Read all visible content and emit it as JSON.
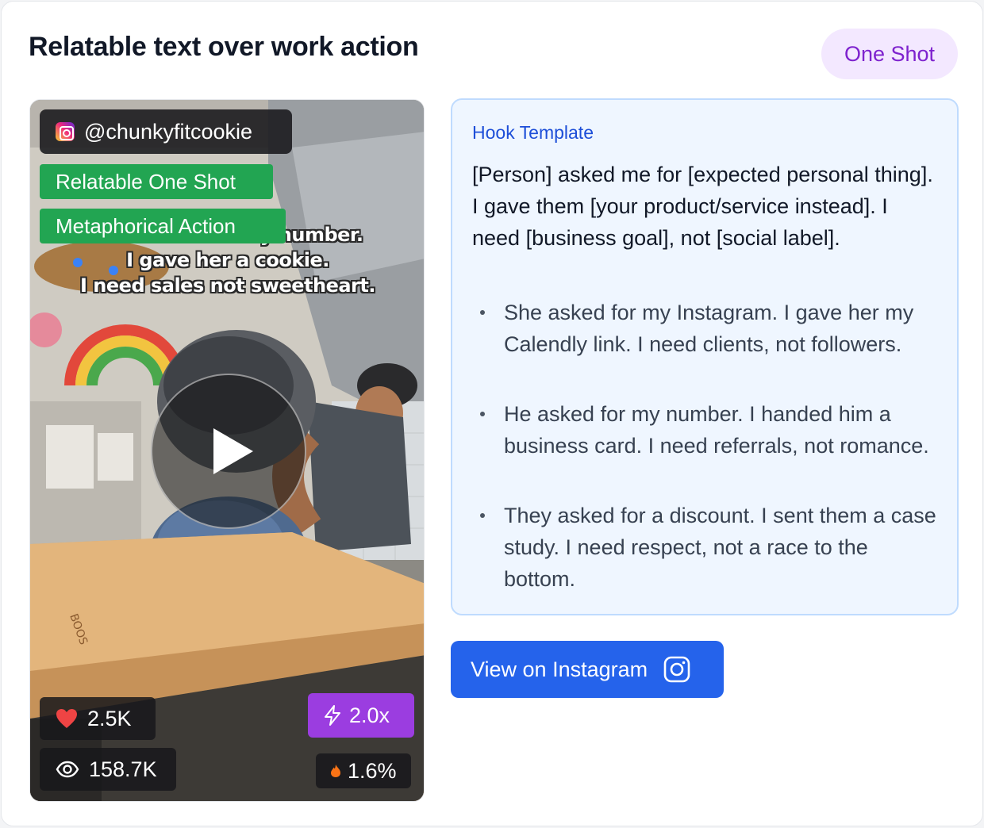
{
  "card": {
    "title": "Relatable text over work action",
    "type_badge": "One Shot"
  },
  "video": {
    "handle": "@chunkyfitcookie",
    "tags": [
      "Relatable One Shot",
      "Metaphorical Action"
    ],
    "caption_lines": [
      "She asked for my number.",
      "I gave her a cookie.",
      "I need sales not sweetheart."
    ],
    "board_brand": "BOOS",
    "likes": "2.5K",
    "views": "158.7K",
    "performance_ratio": "2.0x",
    "engagement_rate": "1.6%",
    "icons": {
      "platform": "instagram-icon",
      "play": "play-icon",
      "likes": "heart-icon",
      "views": "eye-icon",
      "ratio": "lightning-icon",
      "engagement": "flame-icon"
    }
  },
  "hook": {
    "label": "Hook Template",
    "template": "[Person] asked me for [expected personal thing]. I gave them [your product/service instead]. I need [business goal], not [social label].",
    "examples": [
      "She asked for my Instagram. I gave her my Calendly link. I need clients, not followers.",
      "He asked for my number. I handed him a business card. I need referrals, not romance.",
      "They asked for a discount. I sent them a case study. I need respect, not a race to the bottom."
    ]
  },
  "cta": {
    "label": "View on Instagram",
    "icon": "instagram-icon"
  },
  "colors": {
    "badge_bg": "#f3e8ff",
    "badge_text": "#7e22ce",
    "tag_green": "#22a552",
    "ratio_purple": "#9b3de0",
    "hook_bg": "#eff6ff",
    "hook_border": "#bfdbfe",
    "hook_label": "#1d4ed8",
    "button_blue": "#2563eb",
    "heart_red": "#ef4444",
    "flame_orange": "#f97316"
  }
}
